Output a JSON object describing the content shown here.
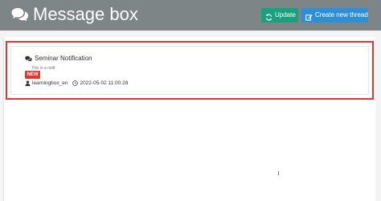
{
  "header": {
    "title": "Message box",
    "title_icon": "comments-icon",
    "background_color": "#7d8586",
    "update_button": {
      "label": "Update",
      "icon": "refresh-icon",
      "color": "#1aa07c"
    },
    "create_button": {
      "label": "Create new thread",
      "icon": "edit-icon",
      "color": "#2f8fd6"
    }
  },
  "threads": [
    {
      "title": "Seminar Notification",
      "title_icon": "comments-icon",
      "preview": "This is a notif",
      "badge": "NEW",
      "badge_color": "#d93a2b",
      "author": "learningbox_en",
      "author_icon": "user-icon",
      "timestamp": "2022-05-02 11:00:28",
      "timestamp_icon": "clock-icon",
      "highlight_color": "#e0363a"
    }
  ]
}
